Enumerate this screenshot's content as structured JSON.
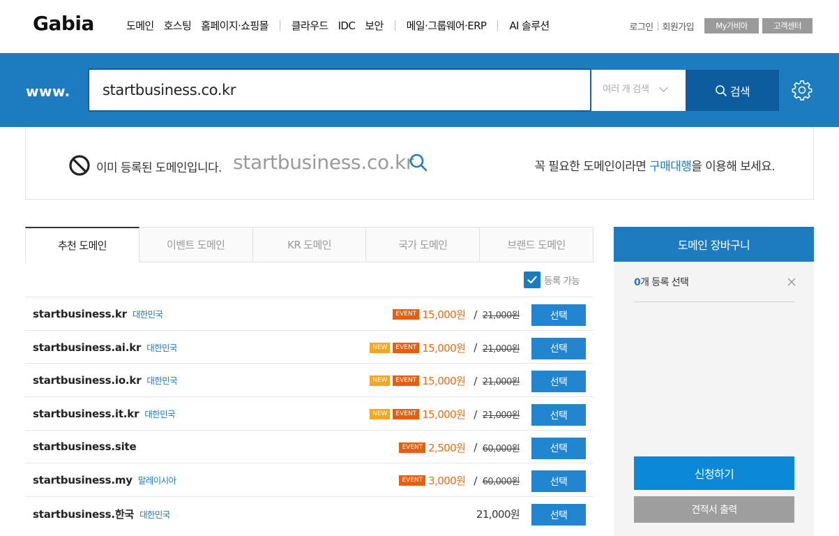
{
  "header": {
    "logo": "Gabia",
    "menu": [
      "도메인",
      "호스팅",
      "홈페이지·쇼핑몰",
      "클라우드",
      "IDC",
      "보안",
      "메일·그룹웨어·ERP",
      "AI 솔루션"
    ],
    "login": "로그인",
    "signup": "회원가입",
    "my_gabia": "My가비아",
    "support": "고객센터"
  },
  "search": {
    "prefix": "www.",
    "value": "startbusiness.co.kr",
    "multi_search": "여러 개 검색",
    "button": "검색"
  },
  "result": {
    "status": "이미 등록된 도메인입니다.",
    "domain": "startbusiness.co.kr",
    "note_prefix": "꼭 필요한 도메인이라면 ",
    "note_link": "구매대행",
    "note_suffix": "을 이용해 보세요."
  },
  "tabs": [
    "추천 도메인",
    "이벤트 도메인",
    "KR 도메인",
    "국가 도메인",
    "브랜드 도메인"
  ],
  "filter": {
    "label": "등록 가능",
    "checked": true
  },
  "domains": [
    {
      "name": "startbusiness.kr",
      "country": "대한민국",
      "new": false,
      "event": true,
      "price": "15,000원",
      "original": "21,000원",
      "select": "선택"
    },
    {
      "name": "startbusiness.ai.kr",
      "country": "대한민국",
      "new": true,
      "event": true,
      "price": "15,000원",
      "original": "21,000원",
      "select": "선택"
    },
    {
      "name": "startbusiness.io.kr",
      "country": "대한민국",
      "new": true,
      "event": true,
      "price": "15,000원",
      "original": "21,000원",
      "select": "선택"
    },
    {
      "name": "startbusiness.it.kr",
      "country": "대한민국",
      "new": true,
      "event": true,
      "price": "15,000원",
      "original": "21,000원",
      "select": "선택"
    },
    {
      "name": "startbusiness.site",
      "country": "",
      "new": false,
      "event": true,
      "price": "2,500원",
      "original": "60,000원",
      "select": "선택"
    },
    {
      "name": "startbusiness.my",
      "country": "말레이시아",
      "new": false,
      "event": true,
      "price": "3,000원",
      "original": "60,000원",
      "select": "선택"
    },
    {
      "name": "startbusiness.한국",
      "country": "대한민국",
      "new": false,
      "event": false,
      "price": "21,000원",
      "original": "",
      "select": "선택"
    }
  ],
  "badges": {
    "new": "NEW",
    "event": "EVENT"
  },
  "cart": {
    "title": "도메인 장바구니",
    "count": "0",
    "count_label": "개 등록 선택",
    "apply": "신청하기",
    "quote": "견적서 출력"
  },
  "colors": {
    "brand_blue": "#1d7bc0",
    "button_blue": "#2185d0",
    "event_orange": "#e85d0e",
    "new_yellow": "#f5a623",
    "sale_orange": "#f06b12"
  }
}
